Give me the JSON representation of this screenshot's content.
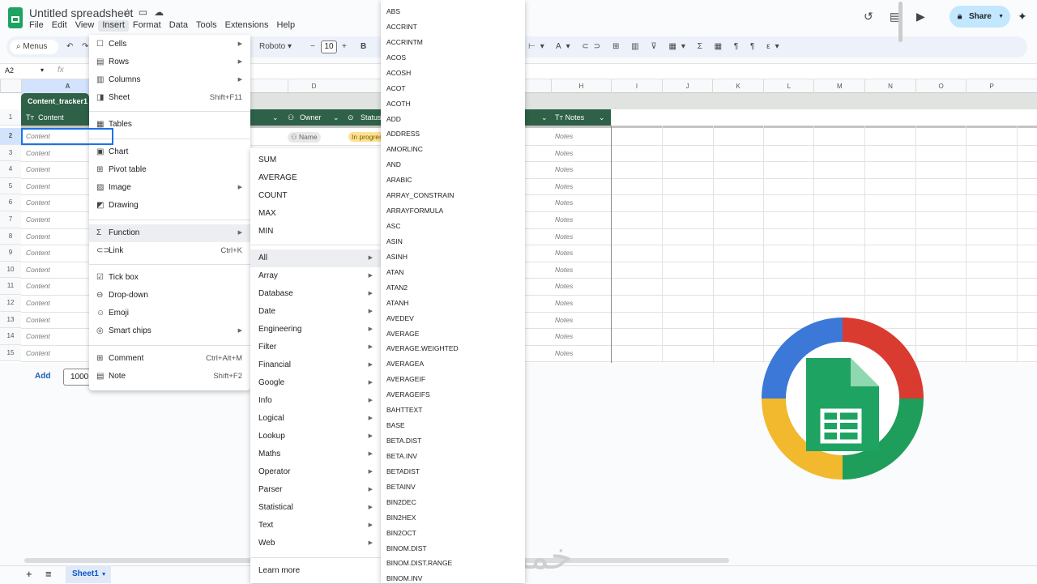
{
  "app": {
    "title": "Untitled spreadsheet",
    "menu": [
      "File",
      "Edit",
      "View",
      "Insert",
      "Format",
      "Data",
      "Tools",
      "Extensions",
      "Help"
    ],
    "active_menu": "Insert",
    "share_label": "Share",
    "watermark": "خمسات"
  },
  "toolbar": {
    "search": "Menus",
    "font": "Roboto",
    "font_size": "10",
    "bold": "B"
  },
  "formula": {
    "cell_ref": "A2",
    "fx": "fx"
  },
  "columns": [
    "A",
    "D",
    "H",
    "I",
    "J",
    "K",
    "L",
    "M",
    "N",
    "O",
    "P"
  ],
  "rows": [
    "1",
    "2",
    "3",
    "4",
    "5",
    "6",
    "7",
    "8",
    "9",
    "10",
    "11",
    "12",
    "13",
    "14",
    "15"
  ],
  "table": {
    "name": "Content_tracker1",
    "headers": {
      "content": "Content",
      "owner": "Owner",
      "status": "Status",
      "notes": "Notes"
    },
    "cell_placeholder": "Content",
    "owner_chip": "Name",
    "status_chip": "In progress",
    "notes_placeholder": "Notes",
    "status_color": "#fde293",
    "header_color": "#2e6147"
  },
  "footer": {
    "add_label": "Add",
    "rows_value": "1000",
    "sheet_tab": "Sheet1"
  },
  "insert_menu": {
    "items": [
      {
        "label": "Cells",
        "icon": "☐",
        "arrow": true
      },
      {
        "label": "Rows",
        "icon": "▤",
        "arrow": true
      },
      {
        "label": "Columns",
        "icon": "▥",
        "arrow": true
      },
      {
        "label": "Sheet",
        "icon": "◨",
        "shortcut": "Shift+F11"
      },
      {
        "label": "Tables",
        "icon": "▦"
      },
      {
        "label": "Chart",
        "icon": "▣"
      },
      {
        "label": "Pivot table",
        "icon": "⊞"
      },
      {
        "label": "Image",
        "icon": "▨",
        "arrow": true
      },
      {
        "label": "Drawing",
        "icon": "◩"
      },
      {
        "label": "Function",
        "icon": "Σ",
        "arrow": true,
        "highlighted": true
      },
      {
        "label": "Link",
        "icon": "⊂⊃",
        "shortcut": "Ctrl+K"
      },
      {
        "label": "Tick box",
        "icon": "☑"
      },
      {
        "label": "Drop-down",
        "icon": "⊖"
      },
      {
        "label": "Emoji",
        "icon": "☺"
      },
      {
        "label": "Smart chips",
        "icon": "◎",
        "arrow": true
      },
      {
        "label": "Comment",
        "icon": "⊞",
        "shortcut": "Ctrl+Alt+M"
      },
      {
        "label": "Note",
        "icon": "▤",
        "shortcut": "Shift+F2"
      }
    ]
  },
  "function_menu": {
    "quick": [
      "SUM",
      "AVERAGE",
      "COUNT",
      "MAX",
      "MIN"
    ],
    "categories": [
      "All",
      "Array",
      "Database",
      "Date",
      "Engineering",
      "Filter",
      "Financial",
      "Google",
      "Info",
      "Logical",
      "Lookup",
      "Maths",
      "Operator",
      "Parser",
      "Statistical",
      "Text",
      "Web"
    ],
    "learn_more": "Learn more"
  },
  "all_functions": [
    "ABS",
    "ACCRINT",
    "ACCRINTM",
    "ACOS",
    "ACOSH",
    "ACOT",
    "ACOTH",
    "ADD",
    "ADDRESS",
    "AMORLINC",
    "AND",
    "ARABIC",
    "ARRAY_CONSTRAIN",
    "ARRAYFORMULA",
    "ASC",
    "ASIN",
    "ASINH",
    "ATAN",
    "ATAN2",
    "ATANH",
    "AVEDEV",
    "AVERAGE",
    "AVERAGE.WEIGHTED",
    "AVERAGEA",
    "AVERAGEIF",
    "AVERAGEIFS",
    "BAHTTEXT",
    "BASE",
    "BETA.DIST",
    "BETA.INV",
    "BETADIST",
    "BETAINV",
    "BIN2DEC",
    "BIN2HEX",
    "BIN2OCT",
    "BINOM.DIST",
    "BINOM.DIST.RANGE",
    "BINOM.INV"
  ]
}
